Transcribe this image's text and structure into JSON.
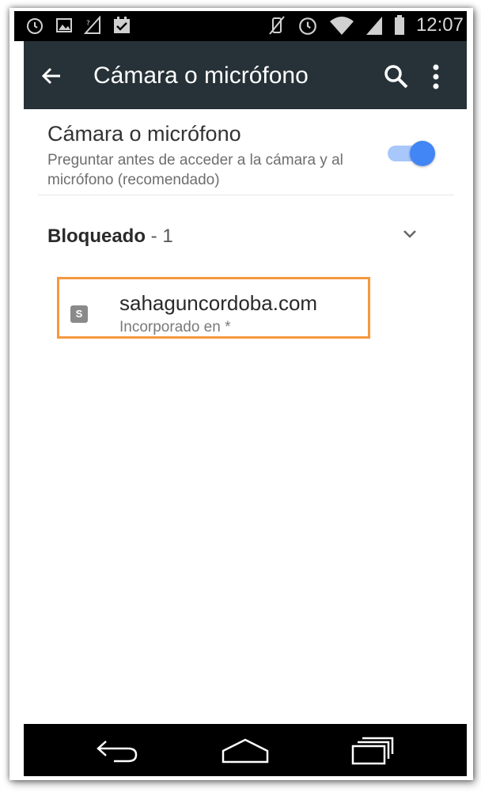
{
  "status_bar": {
    "time": "12:07",
    "left_icons": [
      "alarm-icon",
      "image-notification-icon",
      "signal-notification-icon",
      "calendar-check-icon"
    ],
    "right_icons": [
      "vibrate-off-icon",
      "alarm-icon",
      "wifi-icon",
      "signal-icon",
      "battery-icon"
    ]
  },
  "toolbar": {
    "title": "Cámara o micrófono",
    "background": "#263238"
  },
  "setting": {
    "title": "Cámara o micrófono",
    "description": "Preguntar antes de acceder a la cámara y al micrófono (recomendado)",
    "enabled": true,
    "accent": "#4285f4",
    "track_color": "#a8c7fa"
  },
  "blocked_section": {
    "label": "Bloqueado",
    "separator": " - ",
    "count": "1",
    "expanded": true
  },
  "blocked_sites": [
    {
      "favicon_letter": "S",
      "name": "sahaguncordoba.com",
      "subtitle": "Incorporado en *"
    }
  ],
  "highlight_color": "#f7973d",
  "nav_bar": [
    "back-icon",
    "home-icon",
    "recent-apps-icon"
  ]
}
